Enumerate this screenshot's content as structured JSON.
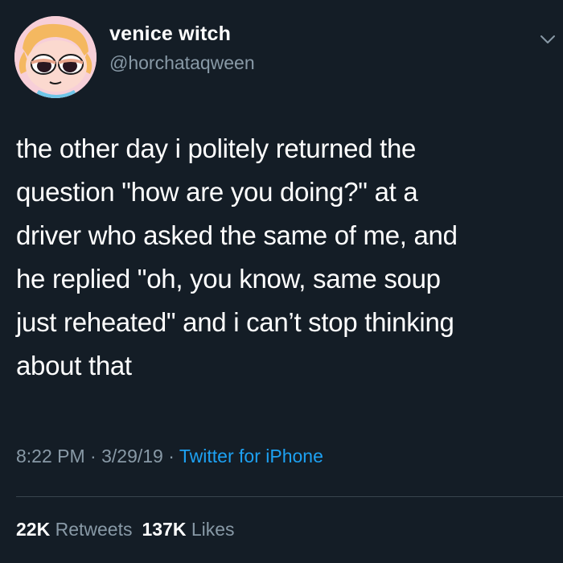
{
  "author": {
    "display_name": "venice witch",
    "handle": "@horchataqween",
    "avatar_icon": "cartoon-girl-avatar-icon"
  },
  "menu_icon": "chevron-down-icon",
  "tweet": {
    "lines": [
      "the other day i politely returned the",
      "question \"how are you doing?\" at a",
      "driver who asked the same of me, and",
      "he replied \"oh, you know, same soup",
      "just reheated\" and i can’t stop thinking",
      "about that"
    ]
  },
  "meta": {
    "time": "8:22 PM",
    "sep1": " · ",
    "date": "3/29/19",
    "sep2": " · ",
    "source": "Twitter for iPhone"
  },
  "stats": {
    "retweets_count": "22K",
    "retweets_label": "Retweets",
    "likes_count": "137K",
    "likes_label": "Likes"
  },
  "colors": {
    "background": "#141d26",
    "text": "#ffffff",
    "secondary_text": "#8899a6",
    "link": "#1da1f2",
    "divider": "#38444d"
  }
}
